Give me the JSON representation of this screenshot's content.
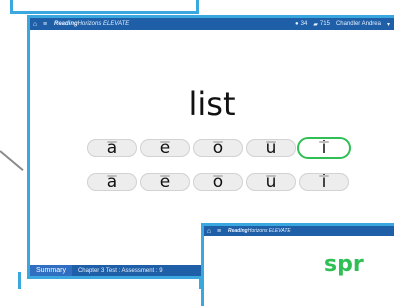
{
  "app": {
    "brand_bold": "Reading",
    "brand_rest": "Horizons ELEVATE",
    "stat1": "34",
    "stat2": "715",
    "user": "Chandler Andrea"
  },
  "question": {
    "word": "list"
  },
  "rows": [
    [
      "a",
      "e",
      "o",
      "u",
      "i"
    ],
    [
      "a",
      "e",
      "o",
      "u",
      "i"
    ]
  ],
  "selected": {
    "row": 0,
    "index": 4
  },
  "statusbar": {
    "summary_label": "Summary",
    "info": "Chapter 3 Test : Assessment : 9"
  },
  "window2": {
    "brand_bold": "Reading",
    "brand_rest": "Horizons ELEVATE",
    "word": "spr"
  },
  "colors": {
    "accent_blue": "#1f5fa8",
    "frame_blue": "#3aa7df",
    "selection_green": "#2fbf55"
  }
}
